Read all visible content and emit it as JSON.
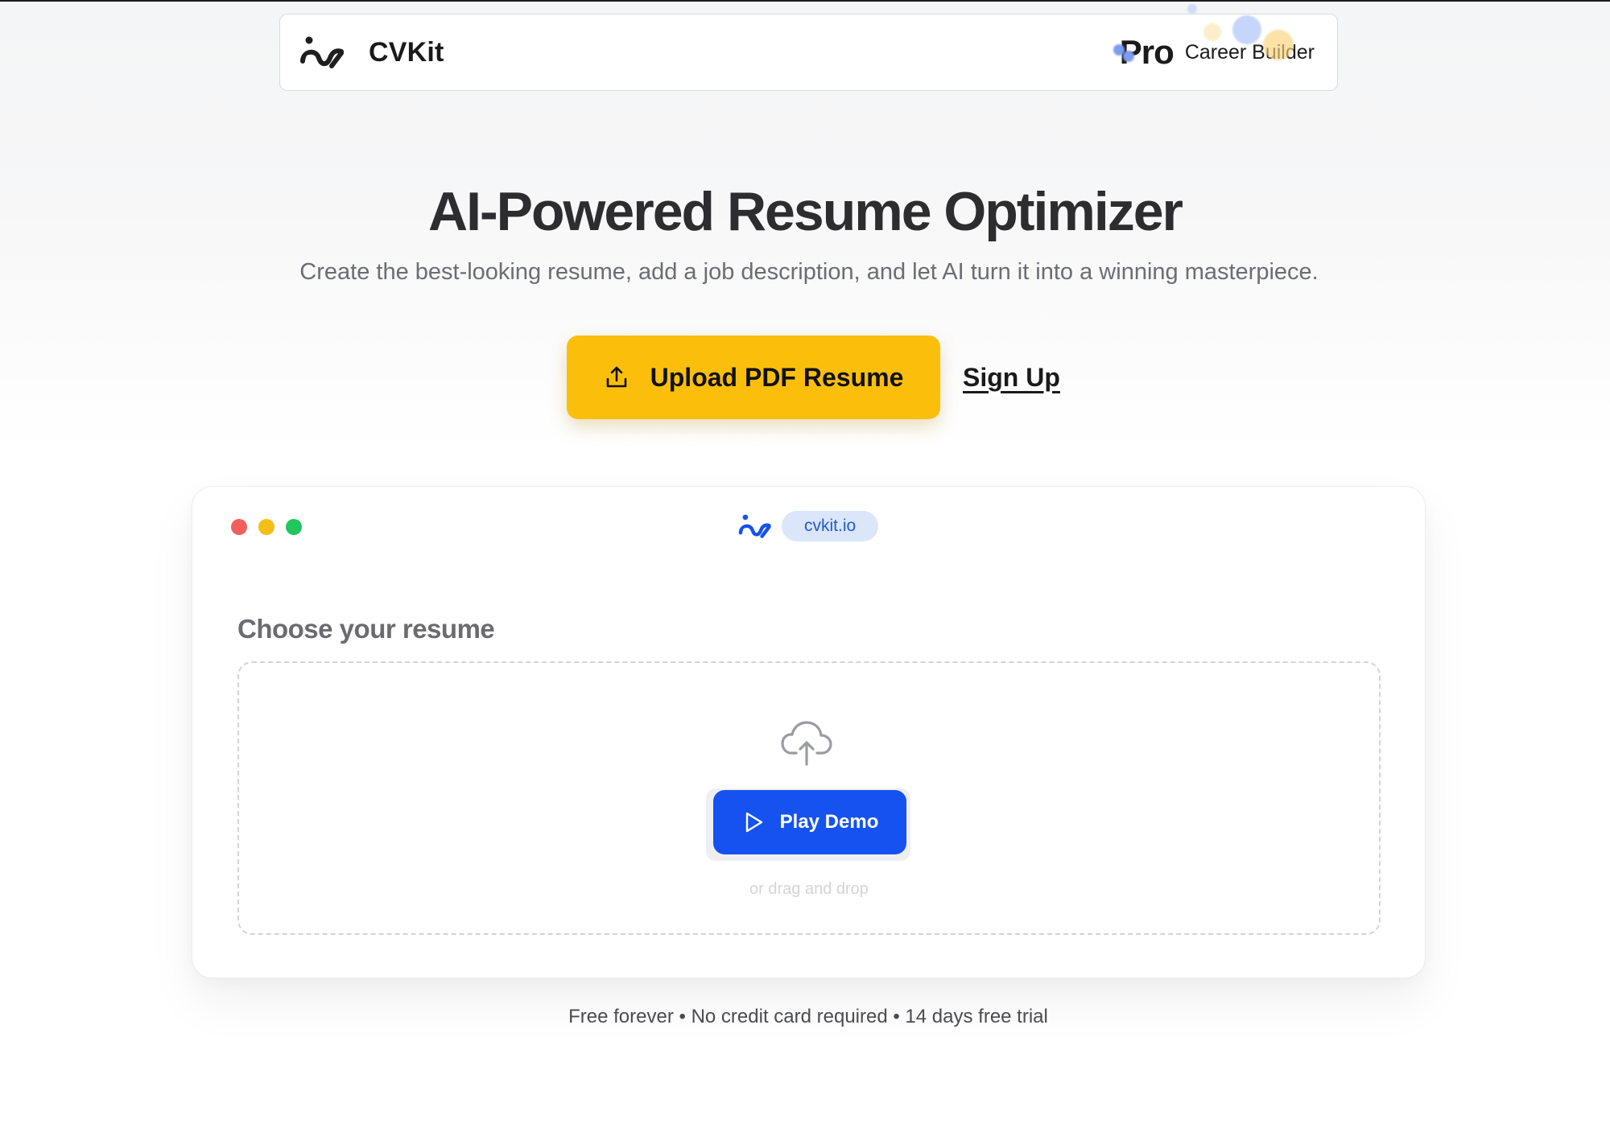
{
  "navbar": {
    "brand_name": "CVKit",
    "pro_label": "Pro",
    "career_label": "Career Builder"
  },
  "hero": {
    "title": "AI-Powered Resume Optimizer",
    "subtitle": "Create the best-looking resume, add a job description, and let AI turn it into a winning masterpiece.",
    "upload_label": "Upload PDF Resume",
    "signup_label": "Sign Up"
  },
  "app_preview": {
    "url": "cvkit.io",
    "section_title": "Choose your resume",
    "play_demo_label": "Play Demo",
    "drag_text": "or drag and drop"
  },
  "footer": {
    "note": "Free forever • No credit card required • 14 days free trial"
  },
  "colors": {
    "upload_button": "#fbbf0b",
    "play_button": "#1552f0",
    "url_pill_bg": "#dbe6fb",
    "url_pill_text": "#1d5bd8",
    "traffic_red": "#f25f5c",
    "traffic_yellow": "#f5be16",
    "traffic_green": "#22c55e"
  },
  "icons": {
    "brand_logo": "cvkit-logo-icon",
    "upload": "upload-icon",
    "cloud_upload": "cloud-upload-icon",
    "play": "play-icon"
  }
}
